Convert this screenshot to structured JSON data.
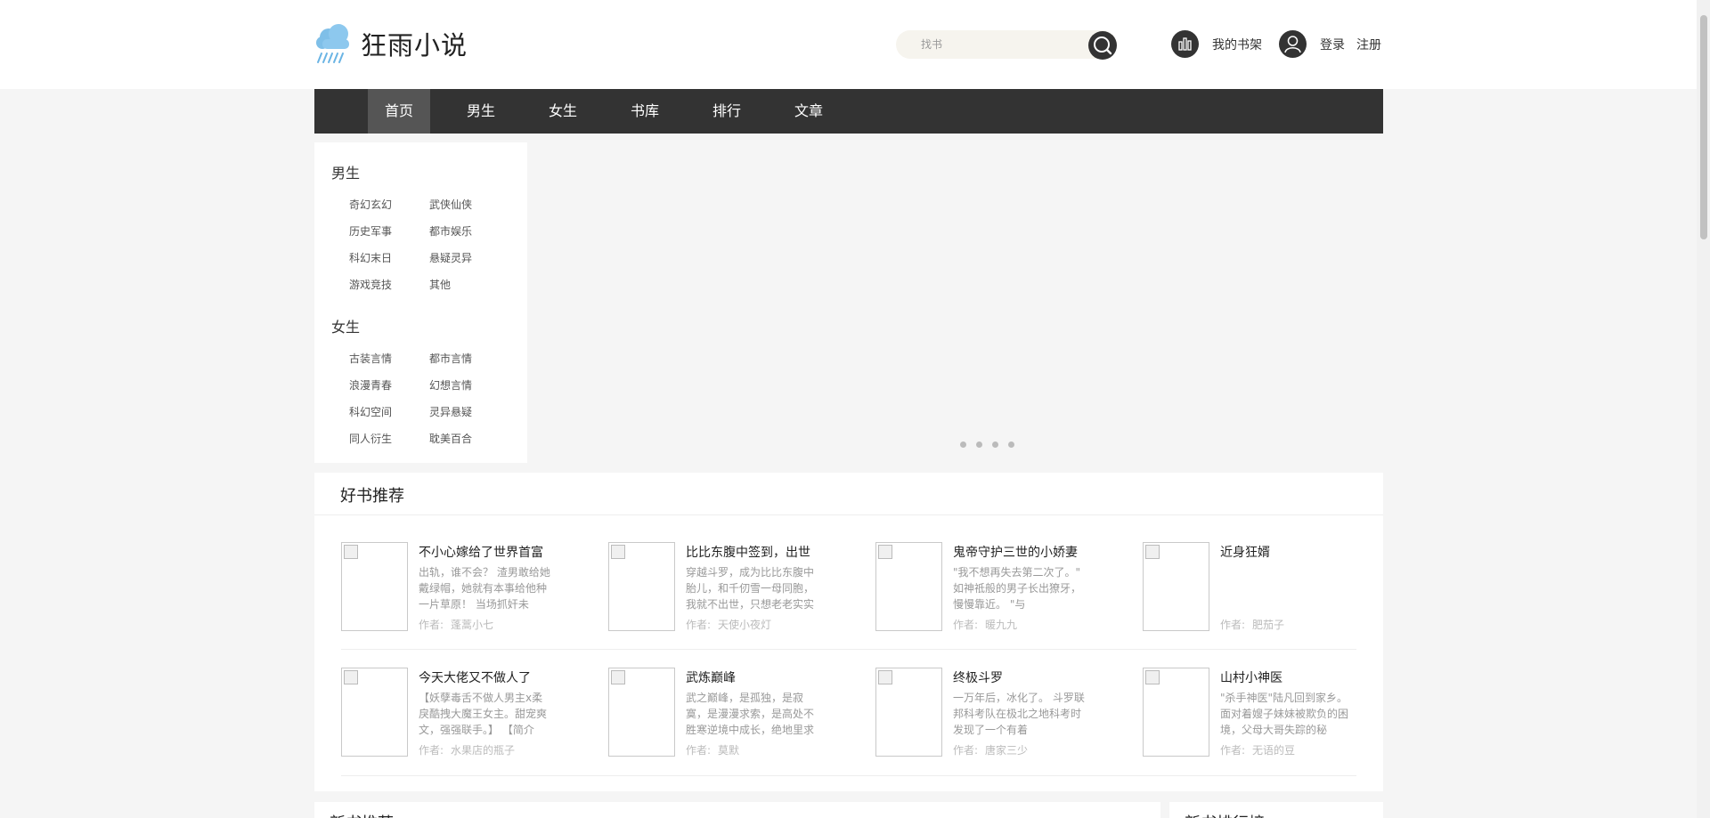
{
  "header": {
    "logo_text": "狂雨小说",
    "search_placeholder": "找书",
    "bookshelf_label": "我的书架",
    "login_label": "登录",
    "register_label": "注册"
  },
  "nav": {
    "items": [
      "首页",
      "男生",
      "女生",
      "书库",
      "排行",
      "文章"
    ],
    "active_index": 0
  },
  "categories": {
    "male": {
      "title": "男生",
      "items": [
        "奇幻玄幻",
        "武侠仙侠",
        "历史军事",
        "都市娱乐",
        "科幻末日",
        "悬疑灵异",
        "游戏竞技",
        "其他"
      ]
    },
    "female": {
      "title": "女生",
      "items": [
        "古装言情",
        "都市言情",
        "浪漫青春",
        "幻想言情",
        "科幻空间",
        "灵异悬疑",
        "同人衍生",
        "耽美百合"
      ]
    }
  },
  "banner": {
    "dot_count": 4
  },
  "recommend": {
    "title": "好书推荐",
    "author_prefix": "作者:",
    "books": [
      {
        "title": "不小心嫁给了世界首富",
        "desc": "出轨，谁不会？ 渣男敢给她戴绿帽，她就有本事给他种一片草原！ 当场抓奸未",
        "author": "蓬蒿小七"
      },
      {
        "title": "比比东腹中签到，出世",
        "desc": "穿越斗罗，成为比比东腹中胎儿，和千仞雪一母同胞，我就不出世，只想老老实实",
        "author": "天使小夜灯"
      },
      {
        "title": "鬼帝守护三世的小娇妻",
        "desc": "\"我不想再失去第二次了。\" 如神祗般的男子长出獠牙，慢慢靠近。 \"与",
        "author": "暖九九"
      },
      {
        "title": "近身狂婿",
        "desc": "",
        "author": "肥茄子"
      },
      {
        "title": "今天大佬又不做人了",
        "desc": "【妖孽毒舌不做人男主x柔戾酷拽大魔王女主。甜宠爽文，强强联手。】 【简介",
        "author": "水果店的瓶子"
      },
      {
        "title": "武炼巅峰",
        "desc": "武之巅峰，是孤独，是寂寞，是漫漫求索，是高处不胜寒逆境中成长，绝地里求",
        "author": "莫默"
      },
      {
        "title": "终极斗罗",
        "desc": "一万年后，冰化了。 斗罗联邦科考队在极北之地科考时发现了一个有着",
        "author": "唐家三少"
      },
      {
        "title": "山村小神医",
        "desc": "\"杀手神医\"陆凡回到家乡。面对着嫂子妹妹被欺负的困境，父母大哥失踪的秘",
        "author": "无语的豆"
      }
    ]
  },
  "bottom": {
    "left_title": "新书推荐",
    "right_title": "新书排行榜"
  }
}
